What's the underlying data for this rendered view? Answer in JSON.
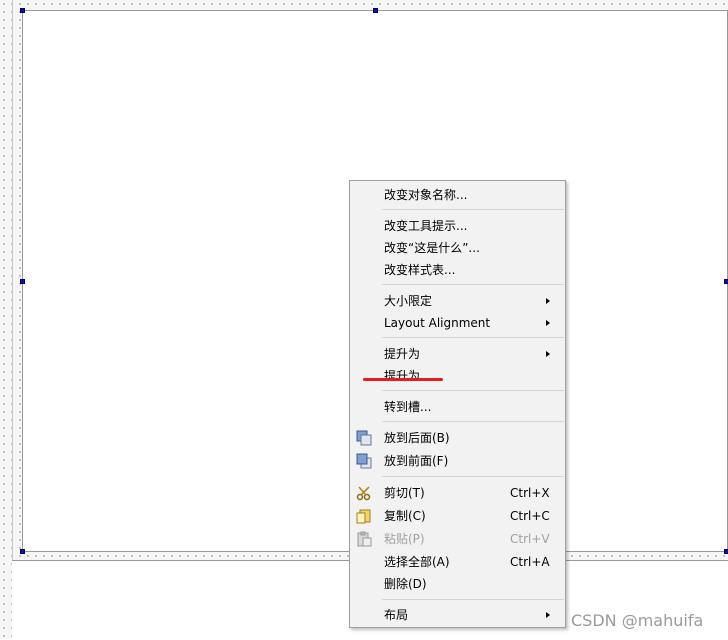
{
  "menu": {
    "items": [
      {
        "label": "改变对象名称..."
      },
      {
        "label": "改变工具提示..."
      },
      {
        "label": "改变“这是什么”..."
      },
      {
        "label": "改变样式表..."
      },
      {
        "label": "大小限定"
      },
      {
        "label": "Layout Alignment"
      },
      {
        "label": "提升为"
      },
      {
        "label": "提升为..."
      },
      {
        "label": "转到槽..."
      },
      {
        "label": "放到后面(B)",
        "icon": "send-to-back-icon"
      },
      {
        "label": "放到前面(F)",
        "icon": "bring-to-front-icon"
      },
      {
        "label": "剪切(T)",
        "shortcut": "Ctrl+X",
        "icon": "scissors-icon"
      },
      {
        "label": "复制(C)",
        "shortcut": "Ctrl+C",
        "icon": "copy-icon"
      },
      {
        "label": "粘贴(P)",
        "shortcut": "Ctrl+V",
        "icon": "paste-icon",
        "disabled": true
      },
      {
        "label": "选择全部(A)",
        "shortcut": "Ctrl+A"
      },
      {
        "label": "删除(D)"
      },
      {
        "label": "布局"
      }
    ]
  },
  "watermark": "CSDN @mahuifa",
  "colors": {
    "annotation": "#e02020",
    "handle": "#1010a0"
  }
}
